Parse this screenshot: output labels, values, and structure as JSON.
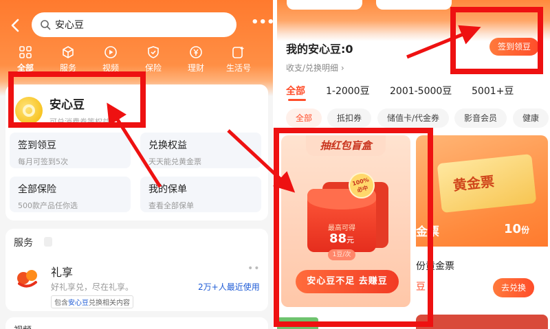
{
  "left": {
    "search": {
      "text": "安心豆"
    },
    "more": "•••",
    "categories": [
      {
        "label": "全部",
        "icon": "grid-icon",
        "active": true
      },
      {
        "label": "服务",
        "icon": "cube-icon"
      },
      {
        "label": "视频",
        "icon": "play-icon"
      },
      {
        "label": "保险",
        "icon": "shield-icon"
      },
      {
        "label": "理财",
        "icon": "yen-icon"
      },
      {
        "label": "生活号",
        "icon": "app-plus-icon"
      }
    ],
    "anxindou": {
      "title": "安心豆",
      "subtitle": "可兑消费券等权益"
    },
    "tiles": [
      {
        "title": "签到领豆",
        "sub": "每月可签到5次"
      },
      {
        "title": "兑换权益",
        "sub": "天天能兑黄金票"
      },
      {
        "title": "全部保险",
        "sub": "500款产品任你选"
      },
      {
        "title": "我的保单",
        "sub": "查看全部保单"
      }
    ],
    "services": {
      "title": "服务",
      "item": {
        "name": "礼享",
        "desc": "好礼享兑，尽在礼享。",
        "count": "2万+人最近使用",
        "tag_prefix": "包含",
        "tag_highlight": "安心豆",
        "tag_suffix": "兑换相关内容"
      }
    },
    "bottom_label": "视频"
  },
  "right": {
    "my_title": "我的安心豆:0",
    "detail_link": "收支/兑换明细",
    "sign_button": "签到领豆",
    "ranges": [
      "全部",
      "1-2000豆",
      "2001-5000豆",
      "5001+豆"
    ],
    "chips": [
      "全部",
      "抵扣券",
      "储值卡/代金券",
      "影音会员",
      "健康"
    ],
    "product1": {
      "ribbon": "抽红包盲盒",
      "badge_line1": "100%",
      "badge_line2": "必中",
      "env_label": "最高可得",
      "env_amount": "88",
      "env_unit": "元",
      "env_rate": "1豆/次",
      "button": "安心豆不足 去赚豆"
    },
    "product2": {
      "ticket_text": "黄金票",
      "left_text": "金票",
      "count": "10",
      "count_unit": "份",
      "name": "份黄金票",
      "dou": "豆",
      "button": "去兑换"
    }
  },
  "annotation_color": "#ee1111"
}
